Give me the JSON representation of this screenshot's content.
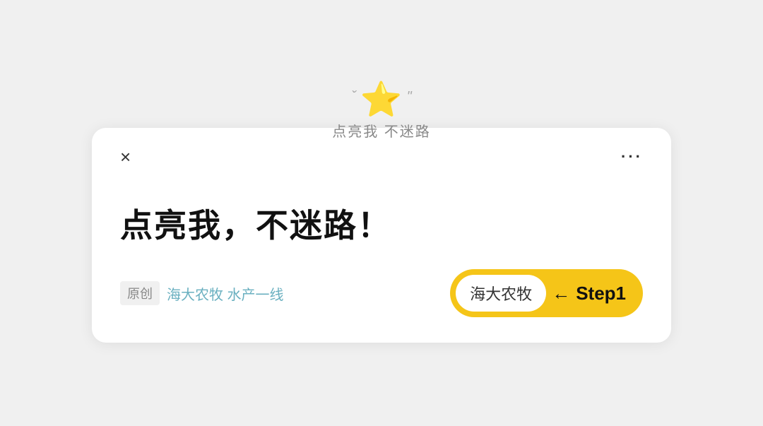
{
  "top": {
    "tick_left": "ˇ",
    "star": "⭐",
    "tick_right": "\"",
    "hint": "点亮我  不迷路"
  },
  "card": {
    "close_label": "×",
    "more_label": "···",
    "title": "点亮我，不迷路！",
    "meta": {
      "original_label": "原创",
      "account1": "海大农牧 水产一线",
      "account2": "海大农牧"
    },
    "step": {
      "arrow": "←",
      "label": "Step1"
    }
  }
}
